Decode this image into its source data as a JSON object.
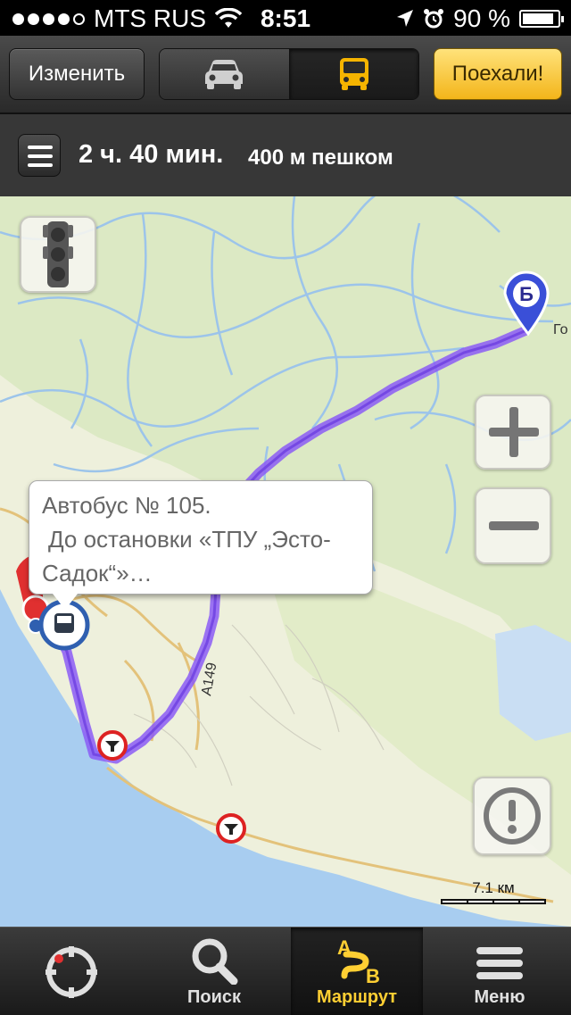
{
  "status_bar": {
    "carrier": "MTS RUS",
    "time": "8:51",
    "battery_percent": "90 %",
    "signal_dots_filled": 4,
    "signal_dots_total": 5,
    "battery_level": 0.9
  },
  "toolbar": {
    "edit_label": "Изменить",
    "go_label": "Поехали!",
    "modes": [
      {
        "icon": "car-icon",
        "active": false
      },
      {
        "icon": "bus-icon",
        "active": true
      }
    ]
  },
  "route_info": {
    "duration": "2 ч. 40 мин.",
    "walking": "400 м пешком"
  },
  "map": {
    "destination_marker": "Б",
    "place_label": "Го",
    "road_label": "А149",
    "callout": {
      "line1": "Автобус № 105.",
      "line2": "До остановки «ТПУ „Эсто-",
      "line3": "Садок“»…"
    },
    "scale_label": "7.1 км",
    "colors": {
      "route": "#8b5cf6",
      "water": "#a8cdf0",
      "land": "#eef0dc",
      "rivers": "#9cc4ea",
      "accent": "#f5b400"
    }
  },
  "tabbar": {
    "tabs": [
      {
        "label": "",
        "icon": "my-location-icon",
        "active": false
      },
      {
        "label": "Поиск",
        "icon": "search-icon",
        "active": false
      },
      {
        "label": "Маршрут",
        "icon": "route-icon",
        "active": true
      },
      {
        "label": "Меню",
        "icon": "menu-icon",
        "active": false
      }
    ],
    "route_icon_letters": {
      "a": "А",
      "b": "В"
    }
  }
}
